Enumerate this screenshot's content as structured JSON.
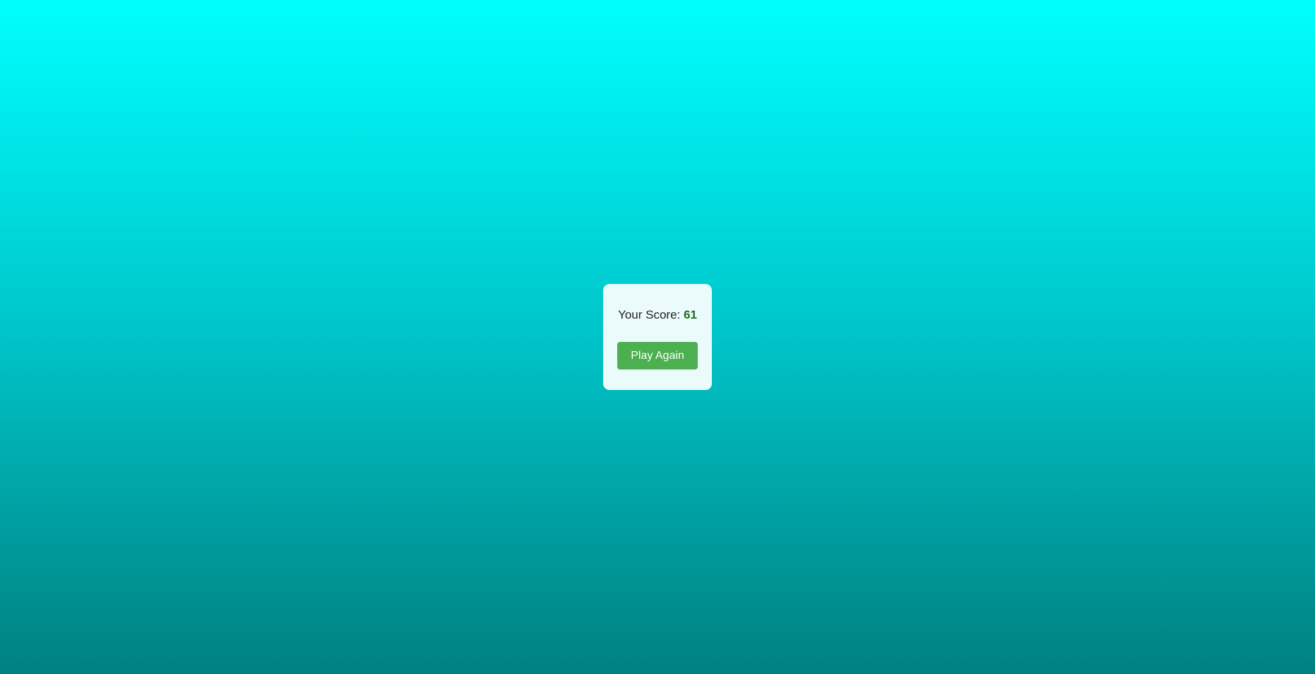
{
  "game_over": {
    "score_label": "Your Score: ",
    "score_value": "61",
    "play_again_label": "Play Again"
  },
  "colors": {
    "background_top": "#00ffff",
    "background_bottom": "#008080",
    "button": "#4caf50",
    "score_value": "#1f6f1f"
  }
}
